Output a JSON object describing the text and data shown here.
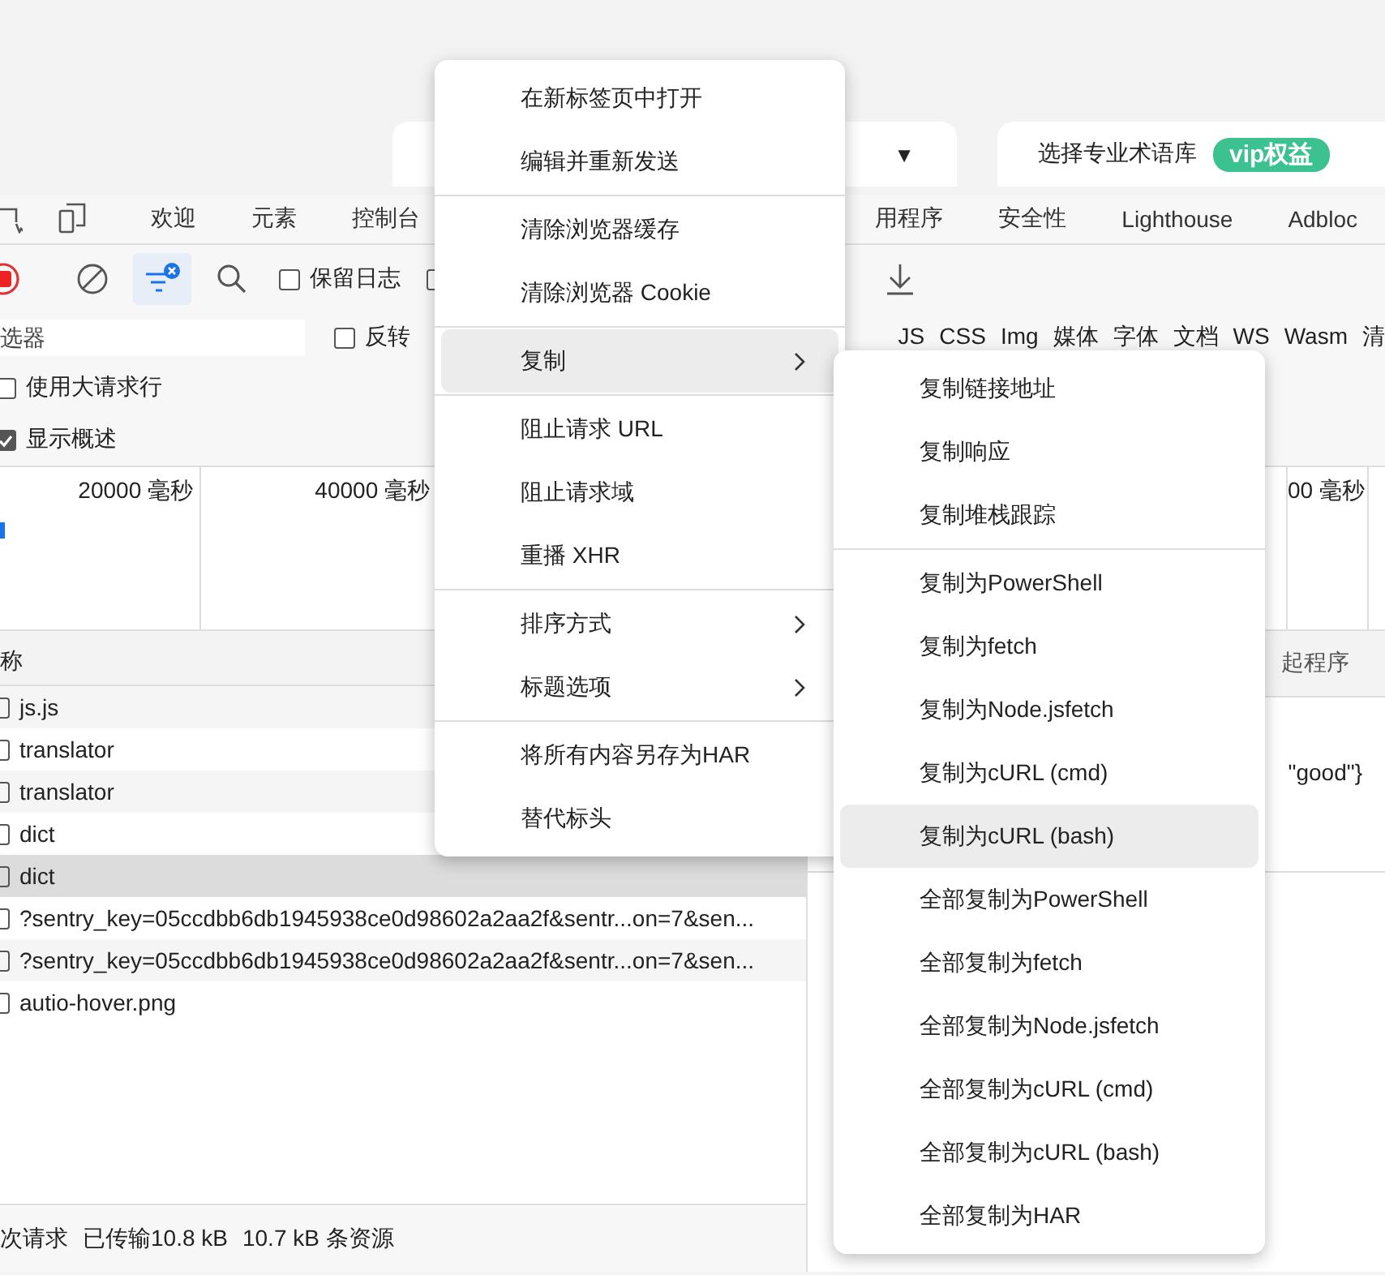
{
  "top_bar": {
    "dropdown_caret": "▼",
    "glossary_label": "选择专业术语库",
    "vip_badge": "vip权益"
  },
  "panel_tabs_left": [
    "欢迎",
    "元素",
    "控制台"
  ],
  "panel_tabs_right": [
    "用程序",
    "安全性",
    "Lighthouse",
    "Adbloc"
  ],
  "toolbar": {
    "preserve_log": {
      "label": "保留日志",
      "checked": false
    },
    "second_checkbox": {
      "checked": false
    }
  },
  "filter": {
    "placeholder": "选器",
    "invert": {
      "label": "反转",
      "checked": false
    },
    "type_chips": [
      "JS",
      "CSS",
      "Img",
      "媒体",
      "字体",
      "文档",
      "WS",
      "Wasm",
      "清"
    ]
  },
  "options": [
    {
      "label": "使用大请求行",
      "checked": false
    },
    {
      "label": "显示概述",
      "checked": true
    }
  ],
  "overview": {
    "ticks": [
      "20000 毫秒",
      "40000 毫秒",
      "00 毫秒"
    ]
  },
  "requests": {
    "column": "称",
    "rows": [
      {
        "name": "js.js",
        "selected": false
      },
      {
        "name": "translator",
        "selected": false
      },
      {
        "name": "translator",
        "selected": false
      },
      {
        "name": "dict",
        "selected": false
      },
      {
        "name": "dict",
        "selected": true
      },
      {
        "name": "?sentry_key=05ccdbb6db1945938ce0d98602a2aa2f&sentr...on=7&sen...",
        "selected": false
      },
      {
        "name": "?sentry_key=05ccdbb6db1945938ce0d98602a2aa2f&sentr...on=7&sen...",
        "selected": false
      },
      {
        "name": "autio-hover.png",
        "selected": false
      }
    ]
  },
  "details": {
    "column": "起程序",
    "preview": "\"good\"}"
  },
  "status_bar": [
    "次请求",
    "已传输10.8 kB",
    "10.7 kB 条资源"
  ],
  "context_menu": {
    "items": [
      {
        "kind": "item",
        "label": "在新标签页中打开",
        "selected": false,
        "submenu": false
      },
      {
        "kind": "item",
        "label": "编辑并重新发送",
        "selected": false,
        "submenu": false
      },
      {
        "kind": "separator"
      },
      {
        "kind": "item",
        "label": "清除浏览器缓存",
        "selected": false,
        "submenu": false
      },
      {
        "kind": "item",
        "label": "清除浏览器 Cookie",
        "selected": false,
        "submenu": false
      },
      {
        "kind": "separator"
      },
      {
        "kind": "item",
        "label": "复制",
        "selected": true,
        "submenu": true
      },
      {
        "kind": "separator"
      },
      {
        "kind": "item",
        "label": "阻止请求 URL",
        "selected": false,
        "submenu": false
      },
      {
        "kind": "item",
        "label": "阻止请求域",
        "selected": false,
        "submenu": false
      },
      {
        "kind": "item",
        "label": "重播 XHR",
        "selected": false,
        "submenu": false
      },
      {
        "kind": "separator"
      },
      {
        "kind": "item",
        "label": "排序方式",
        "selected": false,
        "submenu": true
      },
      {
        "kind": "item",
        "label": "标题选项",
        "selected": false,
        "submenu": true
      },
      {
        "kind": "separator"
      },
      {
        "kind": "item",
        "label": "将所有内容另存为HAR",
        "selected": false,
        "submenu": false
      },
      {
        "kind": "item",
        "label": "替代标头",
        "selected": false,
        "submenu": false
      }
    ]
  },
  "copy_submenu": {
    "items": [
      {
        "kind": "item",
        "label": "复制链接地址",
        "selected": false
      },
      {
        "kind": "item",
        "label": "复制响应",
        "selected": false
      },
      {
        "kind": "item",
        "label": "复制堆栈跟踪",
        "selected": false
      },
      {
        "kind": "separator"
      },
      {
        "kind": "item",
        "label": "复制为PowerShell",
        "selected": false
      },
      {
        "kind": "item",
        "label": "复制为fetch",
        "selected": false
      },
      {
        "kind": "item",
        "label": "复制为Node.jsfetch",
        "selected": false
      },
      {
        "kind": "item",
        "label": "复制为cURL (cmd)",
        "selected": false
      },
      {
        "kind": "item",
        "label": "复制为cURL (bash)",
        "selected": true
      },
      {
        "kind": "item",
        "label": "全部复制为PowerShell",
        "selected": false
      },
      {
        "kind": "item",
        "label": "全部复制为fetch",
        "selected": false
      },
      {
        "kind": "item",
        "label": "全部复制为Node.jsfetch",
        "selected": false
      },
      {
        "kind": "item",
        "label": "全部复制为cURL (cmd)",
        "selected": false
      },
      {
        "kind": "item",
        "label": "全部复制为cURL (bash)",
        "selected": false
      },
      {
        "kind": "item",
        "label": "全部复制为HAR",
        "selected": false
      }
    ]
  }
}
